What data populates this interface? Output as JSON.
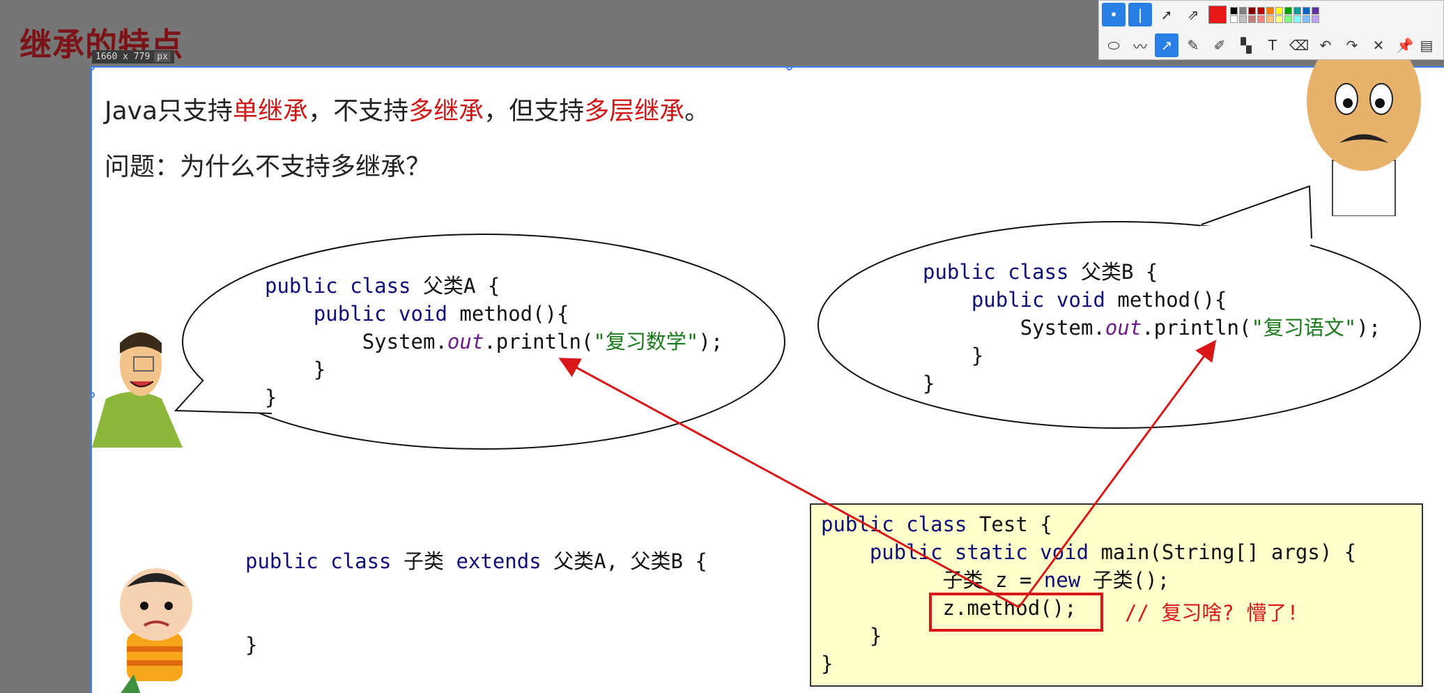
{
  "title": "继承的特点",
  "size_badge": {
    "dims": "1660 x 779",
    "unit": "px"
  },
  "bullets": [
    {
      "pre1": "Java只支持",
      "red1": "单继承",
      "pre2": "，不支持",
      "red2": "多继承",
      "pre3": "，但支持",
      "red3": "多层继承",
      "post": "。"
    },
    {
      "text": "问题：为什么不支持多继承？"
    }
  ],
  "classA": {
    "l1_kw": "public class",
    "l1_name": " 父类A {",
    "l2_kw": "public void",
    "l2_rest": " method(){",
    "l3_a": "System.",
    "l3_out": "out",
    "l3_b": ".println(",
    "l3_str": "\"复习数学\"",
    "l3_c": ");",
    "l4": "}",
    "l5": "}"
  },
  "classB": {
    "l1_kw": "public class",
    "l1_name": " 父类B {",
    "l2_kw": "public void",
    "l2_rest": " method(){",
    "l3_a": "System.",
    "l3_out": "out",
    "l3_b": ".println(",
    "l3_str": "\"复习语文\"",
    "l3_c": ");",
    "l4": "}",
    "l5": "}"
  },
  "subclass": {
    "kw1": "public class",
    "name": " 子类 ",
    "kw2": "extends",
    "rest": " 父类A, 父类B {",
    "close": "}"
  },
  "test": {
    "l1_kw": "public class",
    "l1_rest": " Test {",
    "l2_kw": "public static void",
    "l2_rest": " main(String[] args) {",
    "l3_a": "子类 z = ",
    "l3_kw": "new",
    "l3_b": " 子类();",
    "l4": "z.method();",
    "comment": "// 复习啥? 懵了!",
    "l5": "}",
    "l6": "}"
  },
  "toolbar": {
    "palette": [
      "#000000",
      "#808080",
      "#800000",
      "#c00000",
      "#ff8000",
      "#ffff00",
      "#00a000",
      "#00a0a0",
      "#0060c0",
      "#6030a0",
      "#ffffff",
      "#c0c0c0",
      "#c08080",
      "#ff8080",
      "#ffc080",
      "#ffff80",
      "#80ff80",
      "#80ffff",
      "#80c0ff",
      "#c0a0ff"
    ],
    "selected_color": "#e81818"
  }
}
